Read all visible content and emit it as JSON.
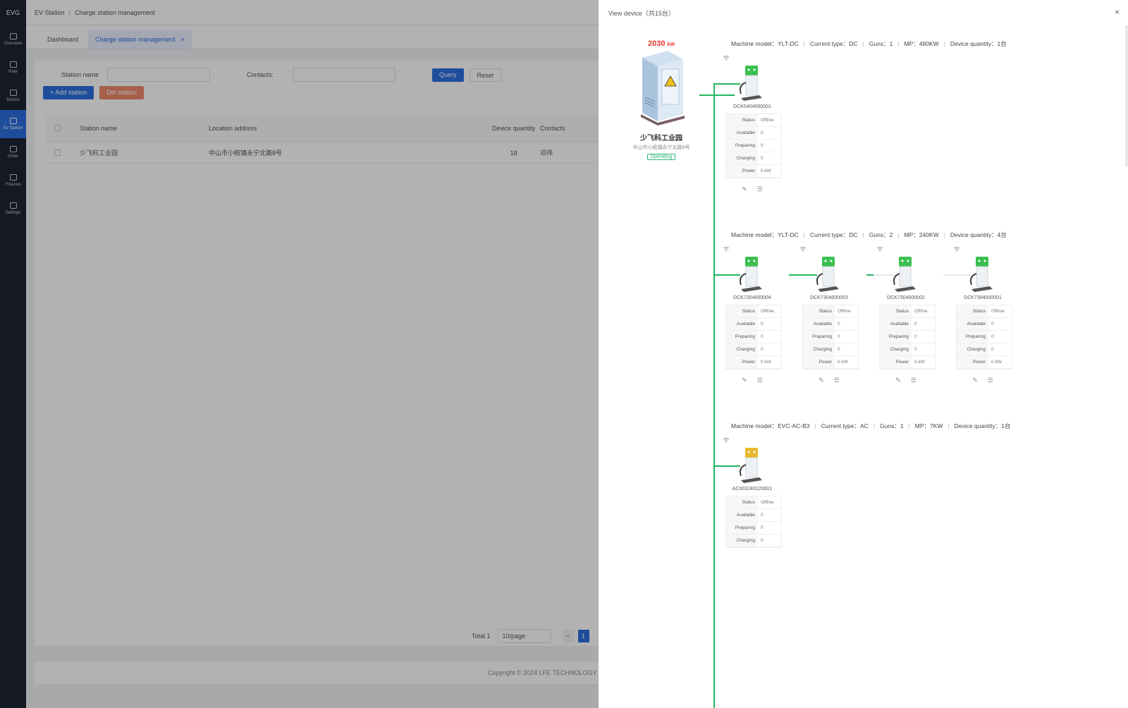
{
  "app": {
    "logo": "EVG"
  },
  "nav": [
    {
      "label": "Overview",
      "icon": "monitor-icon"
    },
    {
      "label": "Rate",
      "icon": "percent-icon"
    },
    {
      "label": "Device",
      "icon": "device-icon"
    },
    {
      "label": "Ev Station",
      "icon": "station-icon",
      "active": true
    },
    {
      "label": "Order",
      "icon": "order-icon"
    },
    {
      "label": "Finance",
      "icon": "finance-icon"
    },
    {
      "label": "Settings",
      "icon": "gear-icon"
    }
  ],
  "breadcrumb": {
    "home": "EV Station",
    "current": "Charge station management"
  },
  "tabs": [
    {
      "label": "Dashboard"
    },
    {
      "label": "Charge station management",
      "close": "×"
    }
  ],
  "filter": {
    "station_label": "Station name",
    "contacts_label": "Contacts:",
    "query": "Query",
    "reset": "Reset",
    "add": "+ Add station",
    "delete": "Del station"
  },
  "table": {
    "headers": [
      "Station name",
      "Location address",
      "Device quantity",
      "Contacts"
    ],
    "rows": [
      {
        "name": "少飞科工业园",
        "address": "中山市小榄镇永宁北路8号",
        "qty": "18",
        "contact": "邓伟"
      }
    ]
  },
  "pager": {
    "total": "Total 1",
    "per_page": "10/page",
    "prev": "<",
    "page": "1"
  },
  "footer": "Copyright © 2024 LFE TECHNOLOGY",
  "drawer": {
    "title": "View device（共15台）",
    "close": "×",
    "station": {
      "power": "2030",
      "power_unit": "kW",
      "name": "少飞科工业园",
      "address": "中山市小榄镇永宁北路8号",
      "status": "Operating"
    },
    "groups": [
      {
        "model": "Machine model：YLT-DC",
        "current": "Current type：DC",
        "guns": "Guns：1",
        "mp": "MP：480KW",
        "qty": "Device quantity：1台",
        "chargers": [
          {
            "name": "DCK5404000001",
            "color": "#3bbf4f",
            "rows": [
              [
                "Status",
                "Offline"
              ],
              [
                "Available",
                "0"
              ],
              [
                "Preparing",
                "0"
              ],
              [
                "Charging",
                "0"
              ],
              [
                "Power",
                "0 kW"
              ]
            ]
          }
        ]
      },
      {
        "model": "Machine model：YLT-DC",
        "current": "Current type：DC",
        "guns": "Guns：2",
        "mp": "MP：240KW",
        "qty": "Device quantity：4台",
        "chargers": [
          {
            "name": "DCK7304000004",
            "color": "#3bbf4f",
            "rows": [
              [
                "Status",
                "Offline"
              ],
              [
                "Available",
                "0"
              ],
              [
                "Preparing",
                "0"
              ],
              [
                "Charging",
                "0"
              ],
              [
                "Power",
                "0 kW"
              ]
            ]
          },
          {
            "name": "DCK7304000003",
            "color": "#3bbf4f",
            "rows": [
              [
                "Status",
                "Offline"
              ],
              [
                "Available",
                "0"
              ],
              [
                "Preparing",
                "0"
              ],
              [
                "Charging",
                "0"
              ],
              [
                "Power",
                "0 kW"
              ]
            ]
          },
          {
            "name": "DCK7304000002",
            "color": "#3bbf4f",
            "rows": [
              [
                "Status",
                "Offline"
              ],
              [
                "Available",
                "0"
              ],
              [
                "Preparing",
                "0"
              ],
              [
                "Charging",
                "0"
              ],
              [
                "Power",
                "0 kW"
              ]
            ]
          },
          {
            "name": "DCK7304000001",
            "color": "#3bbf4f",
            "rows": [
              [
                "Status",
                "Offline"
              ],
              [
                "Available",
                "0"
              ],
              [
                "Preparing",
                "0"
              ],
              [
                "Charging",
                "0"
              ],
              [
                "Power",
                "0 kW"
              ]
            ]
          }
        ]
      },
      {
        "model": "Machine model：EVC-AC-B3",
        "current": "Current type：AC",
        "guns": "Guns：1",
        "mp": "MP：7KW",
        "qty": "Device quantity：1台",
        "chargers": [
          {
            "name": "AC003240120001",
            "color": "#e8b92b",
            "rows": [
              [
                "Status",
                "Offline"
              ],
              [
                "Available",
                "0"
              ],
              [
                "Preparing",
                "0"
              ],
              [
                "Charging",
                "0"
              ]
            ]
          }
        ]
      }
    ]
  }
}
